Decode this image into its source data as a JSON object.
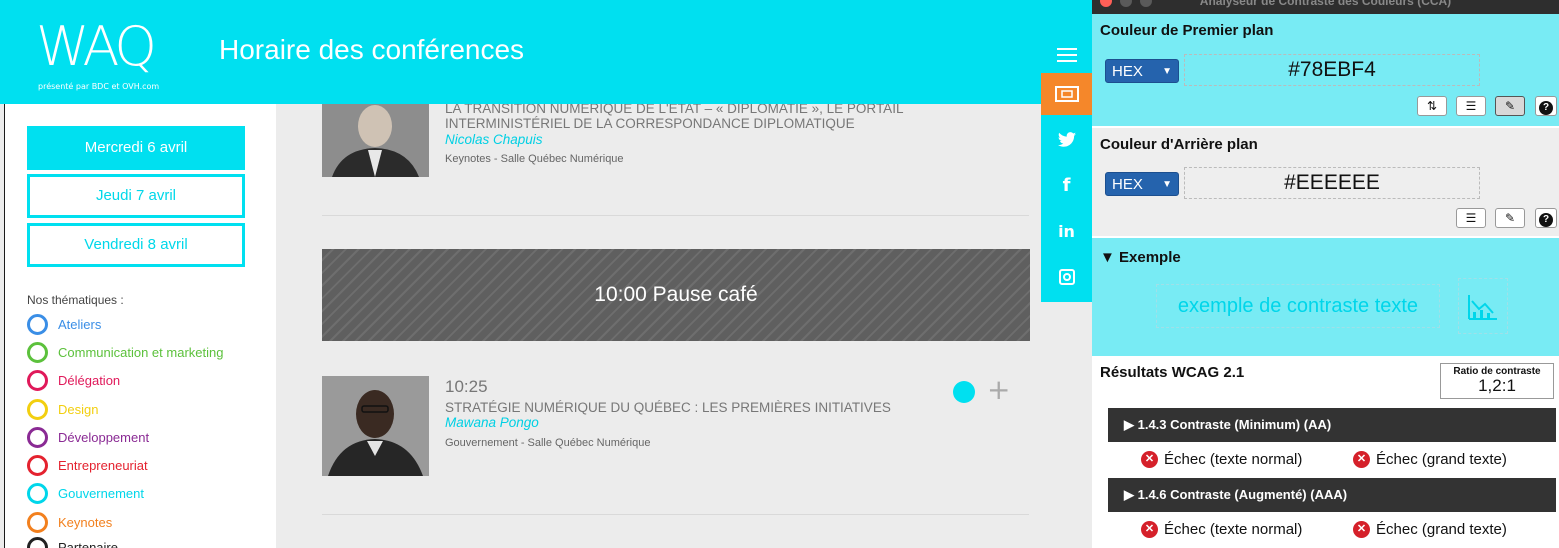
{
  "site": {
    "logo_text": "WAQ",
    "logo_sub": "présenté par  BDC  et  OVH.com",
    "page_title": "Horaire des conférences",
    "days": [
      {
        "label": "Mercredi 6 avril",
        "active": true
      },
      {
        "label": "Jeudi 7 avril",
        "active": false
      },
      {
        "label": "Vendredi 8 avril",
        "active": false
      }
    ],
    "themes_title": "Nos thématiques :",
    "themes": [
      {
        "label": "Ateliers",
        "color": "#3a8ee6"
      },
      {
        "label": "Communication et marketing",
        "color": "#5cc13c"
      },
      {
        "label": "Délégation",
        "color": "#e0195a"
      },
      {
        "label": "Design",
        "color": "#f2cf10"
      },
      {
        "label": "Développement",
        "color": "#8a2a94"
      },
      {
        "label": "Entrepreneuriat",
        "color": "#e4222f"
      },
      {
        "label": "Gouvernement",
        "color": "#00d6ea"
      },
      {
        "label": "Keynotes",
        "color": "#f2801e"
      },
      {
        "label": "Partenaire",
        "color": "#222222"
      }
    ],
    "sessions": [
      {
        "title_line1": "LA TRANSITION NUMÉRIQUE DE L'ÉTAT – « DIPLOMATIE », LE PORTAIL",
        "title_line2": "INTERMINISTÉRIEL DE LA CORRESPONDANCE DIPLOMATIQUE",
        "speaker": "Nicolas Chapuis",
        "room": "Keynotes - Salle Québec Numérique"
      },
      {
        "time": "10:25",
        "title_line1": "STRATÉGIE NUMÉRIQUE DU QUÉBEC : LES PREMIÈRES INITIATIVES",
        "speaker": "Mawana Pongo",
        "room": "Gouvernement - Salle Québec Numérique"
      }
    ],
    "pause": "10:00 Pause café",
    "add_symbol": "+",
    "social": [
      "menu-icon",
      "ticket-icon",
      "twitter-icon",
      "facebook-icon",
      "linkedin-icon",
      "instagram-icon"
    ],
    "social_labels": {
      "facebook": "f",
      "linkedin": "in"
    }
  },
  "panel": {
    "window_title": "Analyseur de Contraste des Couleurs (CCA)",
    "fg_label": "Couleur de Premier plan",
    "fg_format": "HEX",
    "fg_value": "#78EBF4",
    "bg_label": "Couleur d'Arrière plan",
    "bg_format": "HEX",
    "bg_value": "#EEEEEE",
    "example_label": "▼ Exemple",
    "example_text": "exemple de contraste texte",
    "results_label": "Résultats WCAG 2.1",
    "ratio_label": "Ratio de contraste",
    "ratio_value": "1,2:1",
    "help_symbol": "?",
    "fail_symbol": "✕",
    "criteria": [
      {
        "label": "▶  1.4.3 Contraste (Minimum) (AA)",
        "normal": "Échec (texte normal)",
        "large": "Échec (grand texte)"
      },
      {
        "label": "▶  1.4.6 Contraste (Augmenté) (AAA)",
        "normal": "Échec (texte normal)",
        "large": "Échec (grand texte)"
      }
    ],
    "colors": {
      "foreground": "#78EBF4",
      "background": "#EEEEEE",
      "fail": "#D5202A"
    }
  }
}
